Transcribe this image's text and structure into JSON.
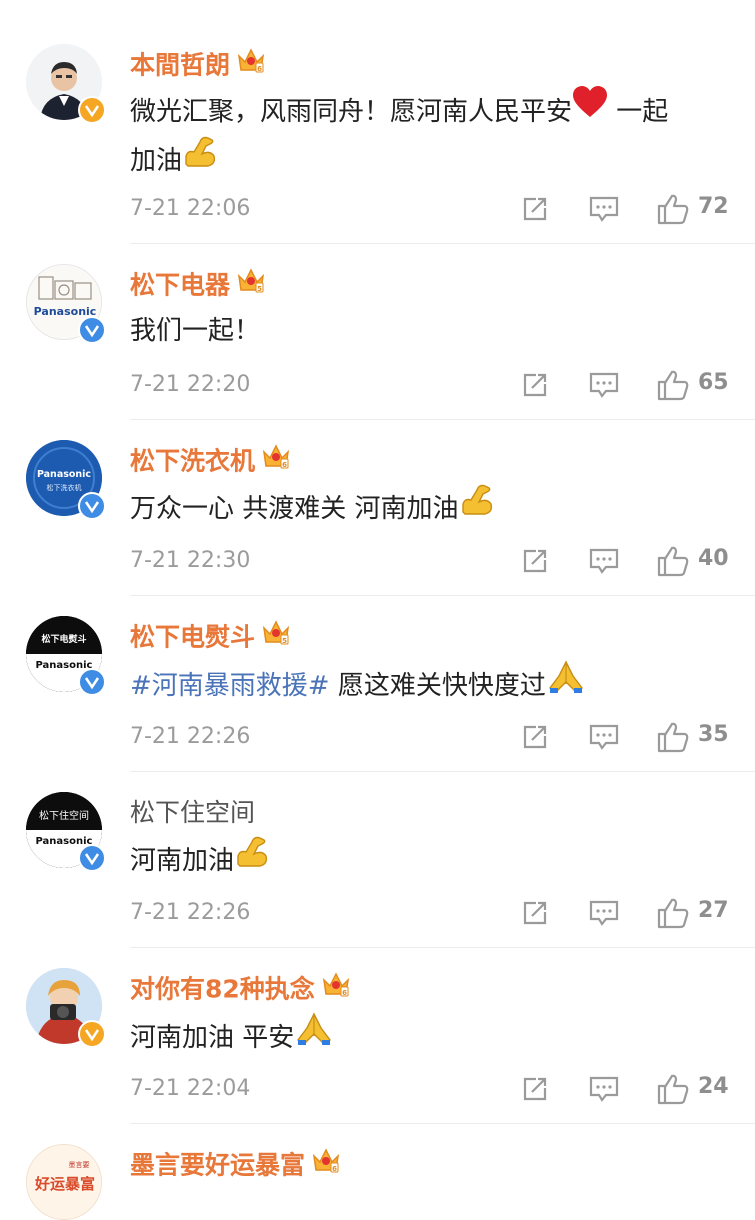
{
  "comments": [
    {
      "name": "本間哲朗",
      "text_plain": "微光汇聚，风雨同舟！愿河南人民平安",
      "text_tail": " 一起",
      "text_line2": "加油",
      "time": "7-21 22:06",
      "likes": "72",
      "verified_color": "#f5a623"
    },
    {
      "name": "松下电器",
      "text_plain": "我们一起！",
      "time": "7-21 22:20",
      "likes": "65",
      "verified_color": "#3e8ce4",
      "avatar_text": "Panasonic"
    },
    {
      "name": "松下洗衣机",
      "text_plain": "万众一心 共渡难关 河南加油",
      "time": "7-21 22:30",
      "likes": "40",
      "verified_color": "#3e8ce4",
      "avatar_text": "Panasonic",
      "avatar_sub": "松下洗衣机"
    },
    {
      "name": "松下电熨斗",
      "hashtag": "#河南暴雨救援#",
      "text_plain": " 愿这难关快快度过",
      "time": "7-21 22:26",
      "likes": "35",
      "verified_color": "#3e8ce4",
      "avatar_text": "Panasonic",
      "avatar_sub": "松下电熨斗"
    },
    {
      "name": "松下住空间",
      "text_plain": "河南加油",
      "time": "7-21 22:26",
      "likes": "27",
      "verified_color": "#3e8ce4",
      "avatar_text": "Panasonic",
      "avatar_sub": "松下住空间"
    },
    {
      "name": "对你有82种执念",
      "text_plain": "河南加油 平安",
      "time": "7-21 22:04",
      "likes": "24",
      "verified_color": "#f5a623"
    },
    {
      "name": "墨言要好运暴富",
      "avatar_text": "好运暴富",
      "avatar_sub": "墨言要"
    }
  ],
  "colors": {
    "name": "#e8773a",
    "hashtag": "#4a73b8",
    "meta": "#9b9b9b",
    "divider": "#ececec"
  },
  "icons": {
    "share": "share-icon",
    "reply": "comment-icon",
    "like": "thumbs-up-icon",
    "crown": "vip-crown-icon",
    "flex": "flexed-biceps-emoji",
    "heart": "red-heart-emoji",
    "pray": "folded-hands-emoji"
  }
}
